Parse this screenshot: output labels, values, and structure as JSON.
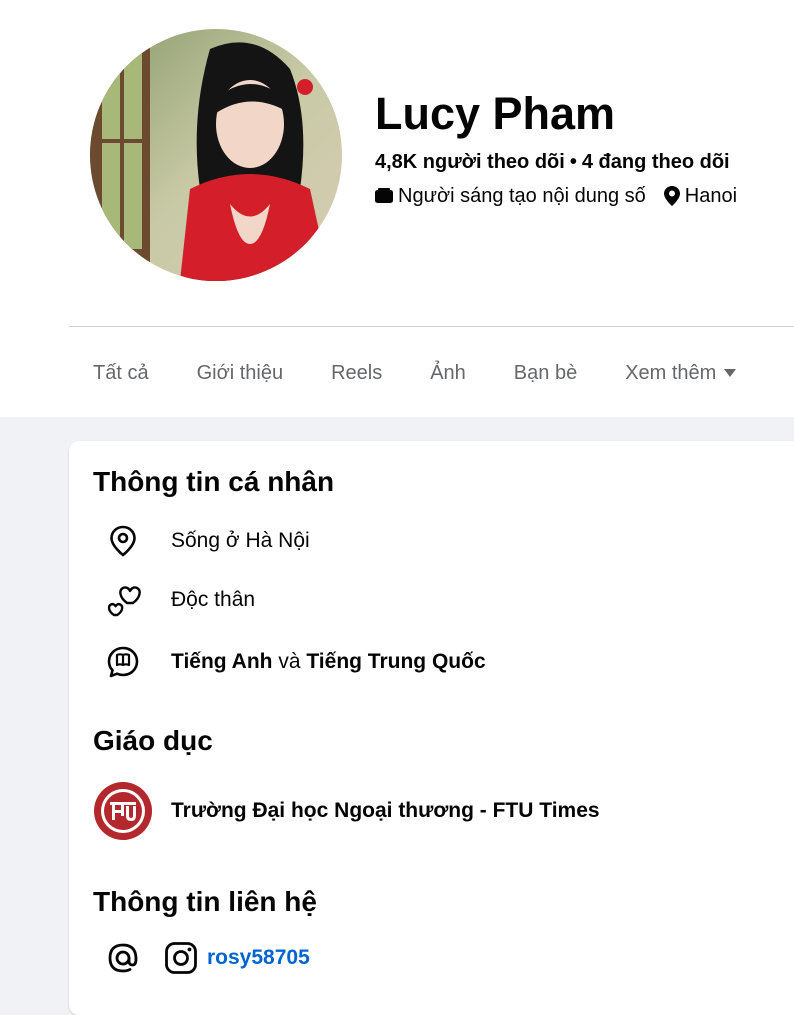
{
  "profile": {
    "name": "Lucy Pham",
    "followers": "4,8K người theo dõi",
    "separator": "•",
    "following": "4 đang theo dõi",
    "category": "Người sáng tạo nội dung số",
    "location": "Hanoi"
  },
  "tabs": [
    {
      "label": "Tất cả"
    },
    {
      "label": "Giới thiệu"
    },
    {
      "label": "Reels"
    },
    {
      "label": "Ảnh"
    },
    {
      "label": "Bạn bè"
    },
    {
      "label": "Xem thêm"
    }
  ],
  "about": {
    "personal_title": "Thông tin cá nhân",
    "lives_in": "Sống ở Hà Nội",
    "relationship": "Độc thân",
    "language_1": "Tiếng Anh",
    "language_conj": " và ",
    "language_2": "Tiếng Trung Quốc",
    "education_title": "Giáo dục",
    "school": "Trường Đại học Ngoại thương - FTU Times",
    "contact_title": "Thông tin liên hệ",
    "instagram": "rosy58705"
  },
  "icons": [
    "location-pin-icon",
    "hearts-icon",
    "language-icon",
    "school-logo",
    "at-icon",
    "instagram-icon",
    "video-icon",
    "caret-down-icon"
  ],
  "colors": {
    "link": "#0064d1",
    "tab_text": "#65676b",
    "background": "#f0f2f5",
    "logo_red": "#b3282d"
  }
}
